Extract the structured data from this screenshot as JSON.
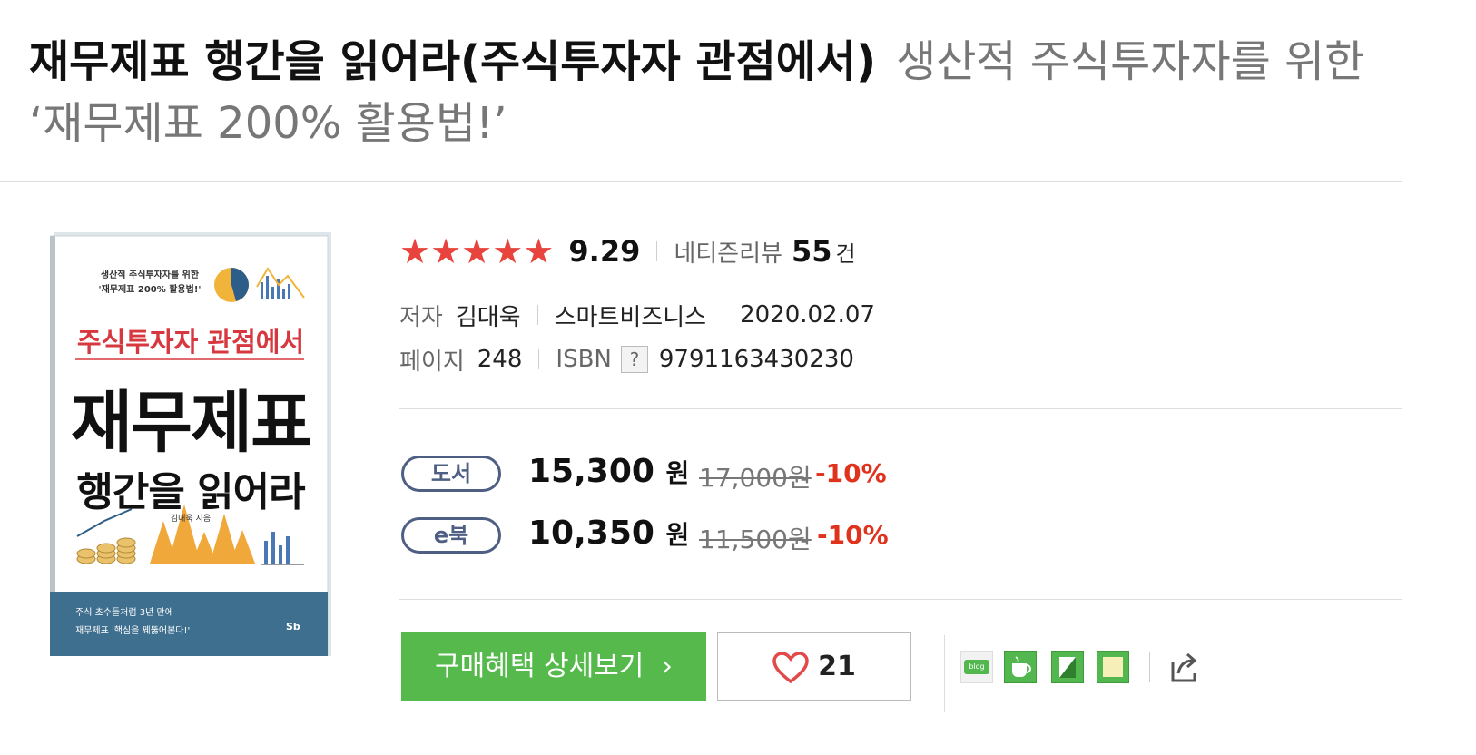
{
  "title": {
    "main": "재무제표 행간을 읽어라(주식투자자 관점에서)",
    "subtitle": "생산적 주식투자자를 위한 ‘재무제표 200% 활용법!’"
  },
  "cover": {
    "top_line1": "생산적 주식투자자를 위한",
    "top_line2": "'재무제표 200% 활용법!'",
    "headline_red": "주식투자자 관점에서",
    "big1": "재무제표",
    "big2": "행간을 읽어라",
    "author": "김대욱 지음",
    "bottom_line1": "주식 초수들처럼 3년 만에",
    "bottom_line2": "재무제표 '핵심을 꿰뚫어본다!'",
    "publisher_logo": "Sb"
  },
  "rating": {
    "score": "9.29",
    "review_label": "네티즌리뷰",
    "review_count": "55",
    "review_unit": "건"
  },
  "meta": {
    "author_label": "저자",
    "author": "김대욱",
    "publisher": "스마트비즈니스",
    "date": "2020.02.07",
    "pages_label": "페이지",
    "pages": "248",
    "isbn_label": "ISBN",
    "isbn_help": "?",
    "isbn": "9791163430230"
  },
  "prices": {
    "book": {
      "tag": "도서",
      "price": "15,300",
      "won": "원",
      "original": "17,000원",
      "discount": "-10%"
    },
    "ebook": {
      "tag": "e북",
      "price": "10,350",
      "won": "원",
      "original": "11,500원",
      "discount": "-10%"
    }
  },
  "actions": {
    "buy_label": "구매혜택 상세보기",
    "buy_arrow": "›",
    "like_count": "21"
  },
  "share": {
    "blog_label": "blog",
    "icons": [
      "blog-icon",
      "cafe-icon",
      "keep-icon",
      "memo-icon",
      "share-icon"
    ]
  },
  "colors": {
    "star": "#e8433c",
    "buy_button": "#55b94c",
    "discount": "#e0331d",
    "pill_border": "#4f5f84"
  }
}
